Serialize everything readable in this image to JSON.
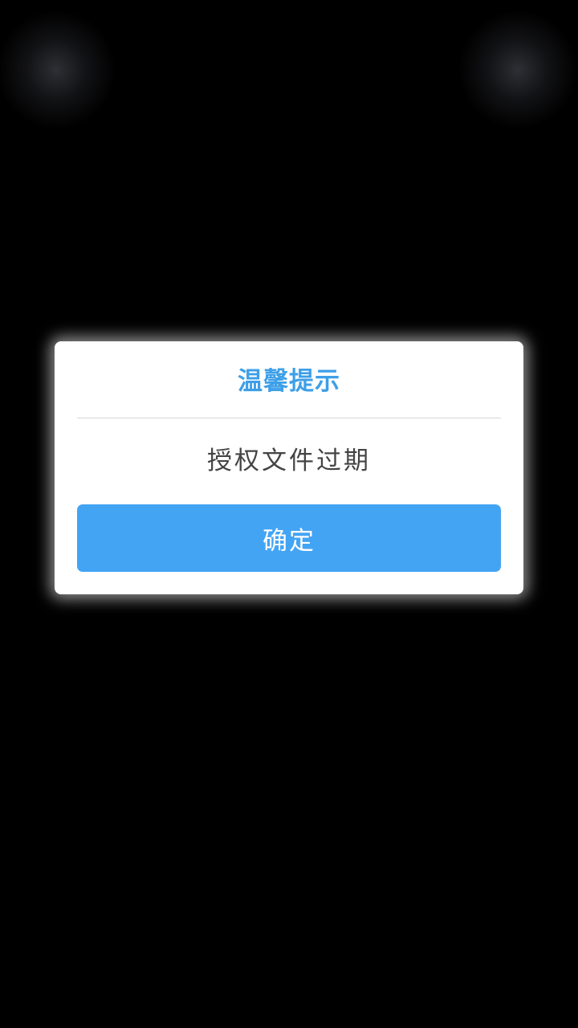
{
  "dialog": {
    "title": "温馨提示",
    "message": "授权文件过期",
    "confirm_label": "确定"
  },
  "colors": {
    "background": "#000000",
    "title": "#3d9fe8",
    "button": "#43a4f4",
    "message": "#444444"
  }
}
